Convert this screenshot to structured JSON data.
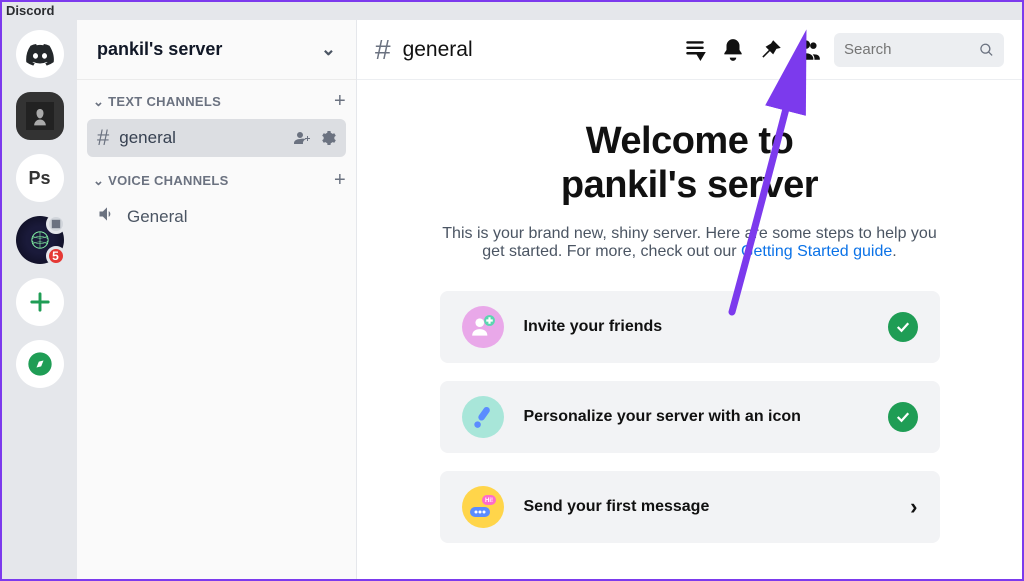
{
  "app_title": "Discord",
  "server_rail": {
    "dm_label": "Direct Messages",
    "servers": [
      {
        "name": "avatar-server",
        "type": "avatar"
      },
      {
        "name": "ps-server",
        "text": "Ps"
      },
      {
        "name": "fifa-server",
        "badge": "5"
      }
    ],
    "add_server": "Add a Server",
    "explore": "Explore"
  },
  "server_header": {
    "name": "pankil's server"
  },
  "sections": {
    "text_label": "TEXT CHANNELS",
    "voice_label": "VOICE CHANNELS"
  },
  "channels": {
    "general": "general",
    "voice_general": "General"
  },
  "topbar": {
    "channel_name": "general",
    "icons": {
      "threads": "threads-icon",
      "notifications": "bell-icon",
      "pinned": "pin-icon",
      "members": "members-icon"
    },
    "search_placeholder": "Search"
  },
  "welcome": {
    "title_line1": "Welcome to",
    "title_line2": "pankil's server",
    "subtitle_a": "This is your brand new, shiny server. Here are some steps to help you get started. For more, check out our ",
    "subtitle_link": "Getting Started guide",
    "subtitle_b": "."
  },
  "cards": [
    {
      "label": "Invite your friends",
      "done": true,
      "icon": "invite"
    },
    {
      "label": "Personalize your server with an icon",
      "done": true,
      "icon": "personalize"
    },
    {
      "label": "Send your first message",
      "done": false,
      "icon": "message"
    }
  ]
}
